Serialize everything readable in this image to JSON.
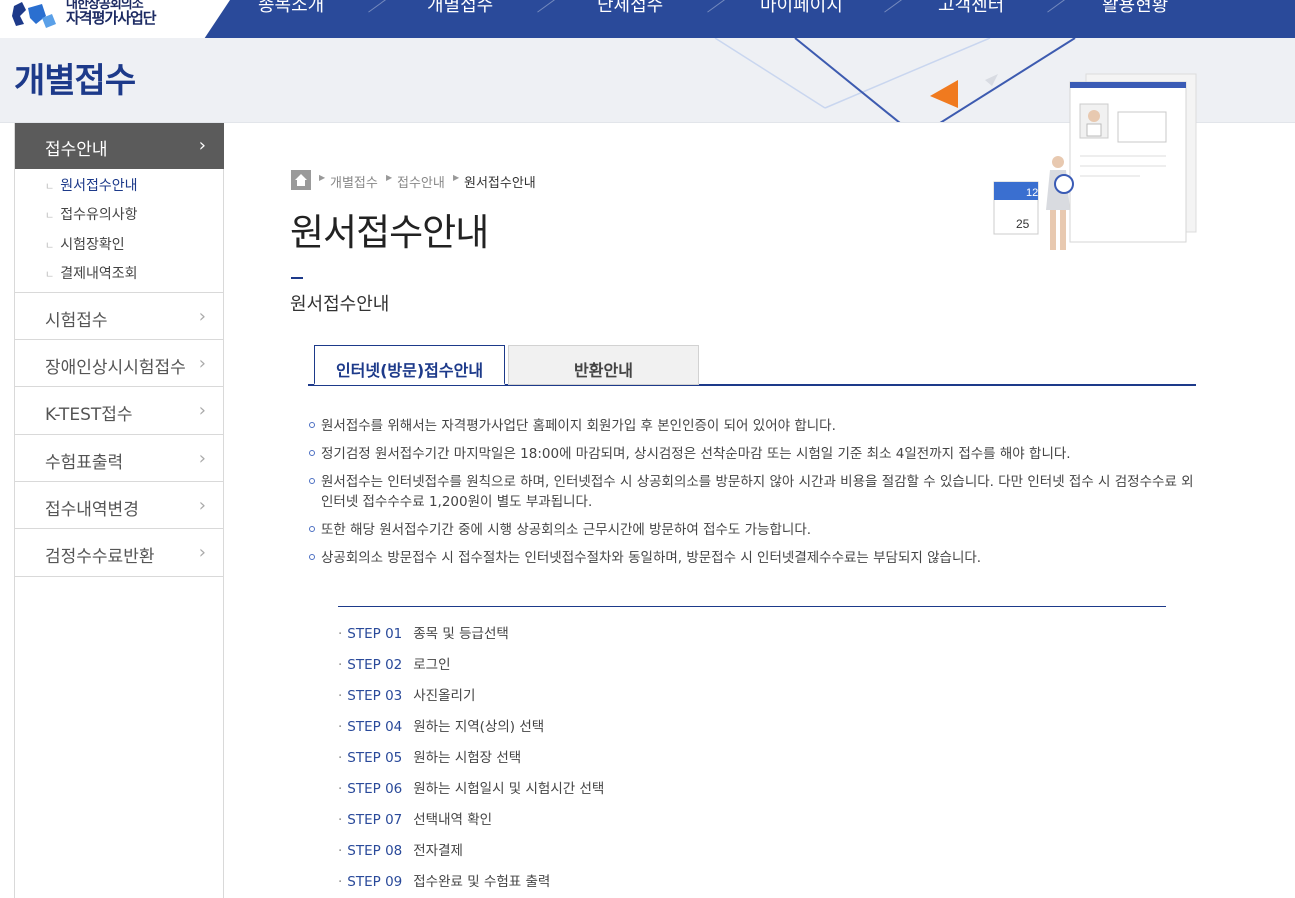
{
  "header": {
    "logo_sub": "대한상공회의소",
    "logo_text": "자격평가사업단",
    "nav": [
      "종목소개",
      "개별접수",
      "단체접수",
      "마이페이지",
      "고객센터",
      "활용현황"
    ]
  },
  "band": {
    "title": "개별접수"
  },
  "sidebar": {
    "active": {
      "label": "접수안내"
    },
    "subs": [
      {
        "label": "원서접수안내"
      },
      {
        "label": "접수유의사항"
      },
      {
        "label": "시험장확인"
      },
      {
        "label": "결제내역조회"
      }
    ],
    "items": [
      {
        "label": "시험접수"
      },
      {
        "label": "장애인상시시험접수"
      },
      {
        "label": "K-TEST접수"
      },
      {
        "label": "수험표출력"
      },
      {
        "label": "접수내역변경"
      },
      {
        "label": "검정수수료반환"
      }
    ]
  },
  "breadcrumb": [
    "개별접수",
    "접수안내",
    "원서접수안내"
  ],
  "main": {
    "title": "원서접수안내",
    "subtitle": "원서접수안내",
    "tabs": [
      "인터넷(방문)접수안내",
      "반환안내"
    ],
    "notices": [
      "원서접수를 위해서는 자격평가사업단 홈페이지 회원가입 후 본인인증이 되어 있어야 합니다.",
      "정기검정 원서접수기간 마지막일은 18:00에 마감되며, 상시검정은 선착순마감 또는 시험일 기준 최소 4일전까지 접수를 해야 합니다.",
      "원서접수는 인터넷접수를 원칙으로 하며, 인터넷접수 시 상공회의소를 방문하지 않아 시간과 비용을 절감할 수 있습니다. 다만 인터넷 접수 시 검정수수료 외 인터넷 접수수수료 1,200원이 별도 부과됩니다.",
      "또한 해당 원서접수기간 중에 시행 상공회의소 근무시간에 방문하여 접수도 가능합니다.",
      "상공회의소 방문접수 시 접수절차는 인터넷접수절차와 동일하며, 방문접수 시 인터넷결제수수료는 부담되지 않습니다."
    ],
    "steps": [
      {
        "num": "STEP 01",
        "label": "종목 및 등급선택"
      },
      {
        "num": "STEP 02",
        "label": "로그인"
      },
      {
        "num": "STEP 03",
        "label": "사진올리기"
      },
      {
        "num": "STEP 04",
        "label": "원하는 지역(상의) 선택"
      },
      {
        "num": "STEP 05",
        "label": "원하는 시험장 선택"
      },
      {
        "num": "STEP 06",
        "label": "원하는 시험일시 및 시험시간 선택"
      },
      {
        "num": "STEP 07",
        "label": "선택내역 확인"
      },
      {
        "num": "STEP 08",
        "label": "전자결제"
      },
      {
        "num": "STEP 09",
        "label": "접수완료 및 수험표 출력"
      }
    ]
  },
  "illustration": {
    "calendar_top": "12",
    "calendar_bottom": "25"
  },
  "colors": {
    "navy": "#2a4a9a",
    "title_blue": "#1d3a8a",
    "sidebar_active": "#5b5b5b",
    "accent_orange": "#f07a1f"
  }
}
